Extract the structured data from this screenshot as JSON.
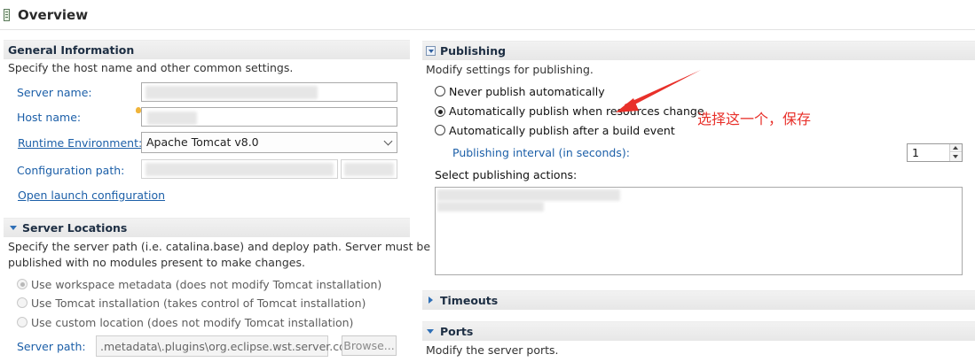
{
  "page_title": "Overview",
  "general": {
    "title": "General Information",
    "desc": "Specify the host name and other common settings.",
    "server_name_label": "Server name:",
    "host_name_label": "Host name:",
    "runtime_label": "Runtime Environment:",
    "runtime_value": "Apache Tomcat v8.0",
    "config_path_label": "Configuration path:",
    "open_launch_label": "Open launch configuration"
  },
  "locations": {
    "title": "Server Locations",
    "desc_line1": "Specify the server path (i.e. catalina.base) and deploy path. Server must be",
    "desc_line2": "published with no modules present to make changes.",
    "options": [
      "Use workspace metadata (does not modify Tomcat installation)",
      "Use Tomcat installation (takes control of Tomcat installation)",
      "Use custom location (does not modify Tomcat installation)"
    ],
    "server_path_label": "Server path:",
    "server_path_value": ".metadata\\.plugins\\org.eclipse.wst.server.co",
    "browse_label": "Browse..."
  },
  "publishing": {
    "title": "Publishing",
    "desc": "Modify settings for publishing.",
    "options": [
      "Never publish automatically",
      "Automatically publish when resources change",
      "Automatically publish after a build event"
    ],
    "selected_option": 1,
    "interval_label": "Publishing interval (in seconds):",
    "interval_value": "1",
    "actions_label": "Select publishing actions:"
  },
  "timeouts": {
    "title": "Timeouts"
  },
  "ports": {
    "title": "Ports",
    "desc": "Modify the server ports."
  },
  "annotation": "选择这一个，保存",
  "colors": {
    "link": "#1c5fa8",
    "section_title": "#1d2e43",
    "annotation": "#e8302a"
  }
}
